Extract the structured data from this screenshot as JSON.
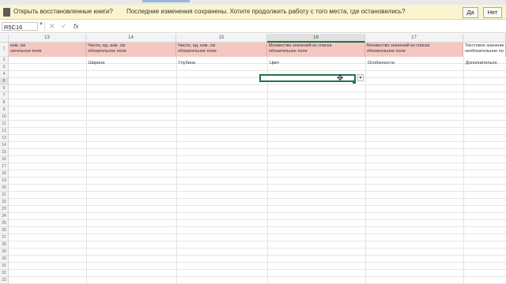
{
  "message_bar": {
    "question": "Открыть восстановленные книги?",
    "detail": "Последние изменения сохранены. Хотите продолжить работу с того места, где остановились?",
    "yes_label": "Да",
    "no_label": "Нет"
  },
  "formula_bar": {
    "name_box": "R5C16",
    "fx_label": "fx",
    "cancel_label": "✕",
    "enter_label": "✓",
    "value": ""
  },
  "columns": [
    "13",
    "14",
    "15",
    "16",
    "17",
    ""
  ],
  "selected_column": "16",
  "rows": [
    "1",
    "2",
    "3",
    "4",
    "5",
    "6",
    "7",
    "8",
    "9",
    "10",
    "11",
    "12",
    "13",
    "14",
    "15",
    "16",
    "17",
    "18",
    "19",
    "20",
    "21",
    "22",
    "23",
    "24",
    "25",
    "26",
    "27",
    "28",
    "29",
    "30",
    "31",
    "32",
    "33"
  ],
  "selected_row": "5",
  "header_row": [
    {
      "line1": "изм. см",
      "line2": "зательное поле"
    },
    {
      "line1": "Число, ед. изм. см",
      "line2": "обязательное поле"
    },
    {
      "line1": "Число, ед. изм. см",
      "line2": "обязательное поле"
    },
    {
      "line1": "Множество значений из списка",
      "line2": "обязательное поле"
    },
    {
      "line1": "Множество значений из списка",
      "line2": "обязательное поле"
    },
    {
      "line1": "Текстовое значение",
      "line2": "необязательное поле"
    }
  ],
  "label_row": [
    "",
    "Ширина",
    "Глубина",
    "Цвет",
    "Особенности",
    "Дополнительно"
  ],
  "colors": {
    "required_fill": "#f4c7c3",
    "optional_fill": "#ffffff",
    "selection_border": "#217346",
    "message_bar_bg": "#fbf5cf"
  }
}
